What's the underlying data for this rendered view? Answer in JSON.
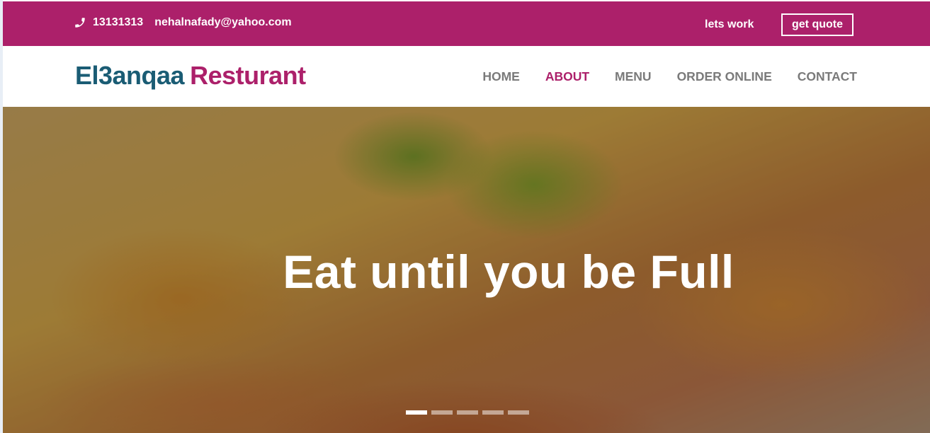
{
  "topbar": {
    "phone_icon": "phone-icon",
    "phone": "13131313",
    "email": "nehalnafady@yahoo.com",
    "lets_work": "lets work",
    "get_quote": "get quote"
  },
  "brand": {
    "part1": "El3anqaa",
    "part2": "Resturant"
  },
  "nav": {
    "items": [
      {
        "label": "HOME"
      },
      {
        "label": "ABOUT",
        "active": true
      },
      {
        "label": "MENU"
      },
      {
        "label": "ORDER ONLINE"
      },
      {
        "label": "CONTACT"
      }
    ]
  },
  "hero": {
    "title": "Eat until you be Full",
    "slides_count": 5,
    "active_slide": 1
  },
  "colors": {
    "brand_primary": "#ac206a",
    "brand_secondary": "#1a5c74",
    "nav_text": "#7a7a7a"
  }
}
